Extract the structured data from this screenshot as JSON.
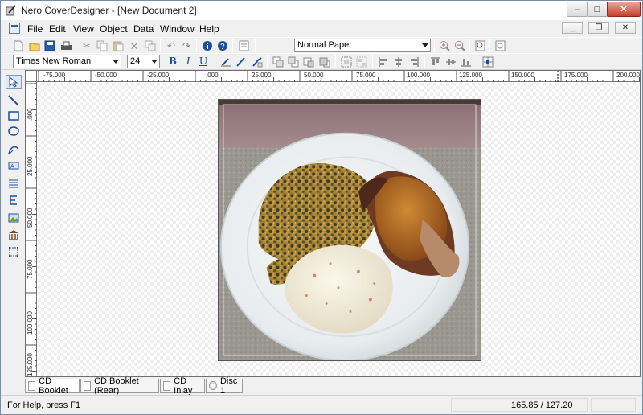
{
  "window": {
    "title": "Nero CoverDesigner - [New Document 2]"
  },
  "title_controls": {
    "minimize": "–",
    "maximize": "□",
    "close": "✕"
  },
  "menu": {
    "items": [
      "File",
      "Edit",
      "View",
      "Object",
      "Data",
      "Window",
      "Help"
    ]
  },
  "mdi_controls": {
    "minimize": "_",
    "restore": "❐",
    "close": "✕"
  },
  "toolbar1": {
    "paper_select": "Normal Paper",
    "icons": [
      "new-icon",
      "open-icon",
      "save-icon",
      "print-icon",
      "cut-icon",
      "copy-icon",
      "paste-icon",
      "delete-icon",
      "duplicate-icon",
      "undo-icon",
      "redo-icon",
      "info-icon",
      "help-icon",
      "document-properties-icon",
      "zoom-in-icon",
      "zoom-out-icon",
      "zoom-page-icon",
      "zoom-fit-icon"
    ]
  },
  "toolbar2": {
    "font_family": "Times New Roman",
    "font_size": "24",
    "bold": "B",
    "italic": "I",
    "underline": "U"
  },
  "tools": [
    "pointer-tool",
    "line-tool",
    "rectangle-tool",
    "ellipse-tool",
    "pen-tool",
    "text-tool",
    "list-tool",
    "field-tool",
    "image-tool",
    "object-tool",
    "frame-tool"
  ],
  "ruler": {
    "h_labels": [
      "-75.000",
      "-50.000",
      "-25.000",
      ".000",
      "25.000",
      "50.000",
      "75.000",
      "100.000",
      "125.000",
      "150.000",
      "175.000",
      "200.000"
    ],
    "v_labels": [
      ".000",
      "25.000",
      "50.000",
      "75.000",
      "100.000",
      "125.000"
    ]
  },
  "tabs": [
    "CD Booklet",
    "CD Booklet (Rear)",
    "CD Inlay",
    "Disc 1"
  ],
  "status": {
    "help": "For Help, press F1",
    "coords": "165.85 / 127.20"
  },
  "colors": {
    "accent": "#1f4e9c",
    "close_button": "#c7402c"
  }
}
